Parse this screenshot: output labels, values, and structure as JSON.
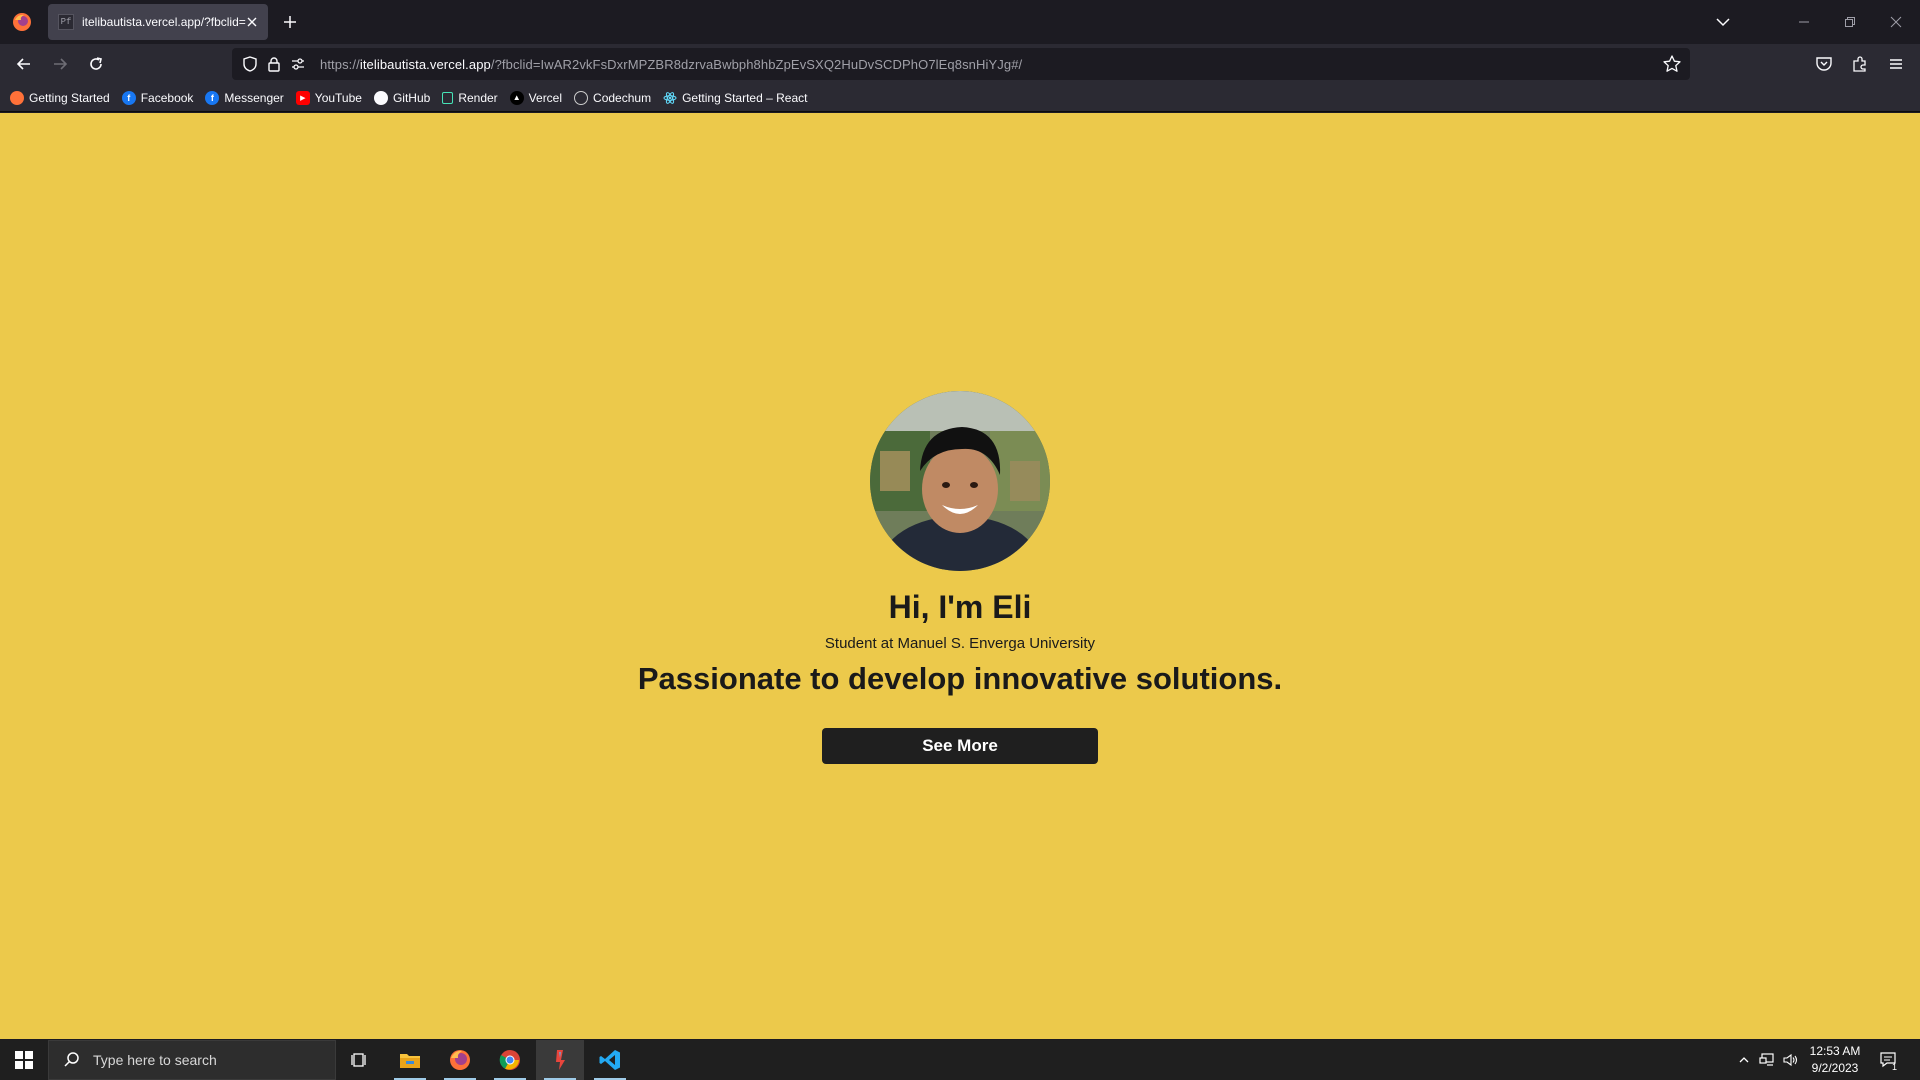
{
  "browser": {
    "tab": {
      "favicon_text": "Pf",
      "title": "itelibautista.vercel.app/?fbclid="
    },
    "url": {
      "scheme": "https://",
      "host": "itelibautista.vercel.app",
      "path": "/?fbclid=IwAR2vkFsDxrMPZBR8dzrvaBwbph8hbZpEvSXQ2HuDvSCDPhO7lEq8snHiYJg#/"
    },
    "bookmarks": [
      {
        "label": "Getting Started",
        "icon": "firefox-icon",
        "color": "#ff7139"
      },
      {
        "label": "Facebook",
        "icon": "facebook-icon",
        "color": "#1877f2"
      },
      {
        "label": "Messenger",
        "icon": "facebook-icon",
        "color": "#1877f2"
      },
      {
        "label": "YouTube",
        "icon": "youtube-icon",
        "color": "#ff0000"
      },
      {
        "label": "GitHub",
        "icon": "github-icon",
        "color": "#ffffff"
      },
      {
        "label": "Render",
        "icon": "render-icon",
        "color": "#46e3b7"
      },
      {
        "label": "Vercel",
        "icon": "vercel-icon",
        "color": "#ffffff"
      },
      {
        "label": "Codechum",
        "icon": "codechum-icon",
        "color": "#cccccc"
      },
      {
        "label": "Getting Started – React",
        "icon": "react-icon",
        "color": "#61dafb"
      }
    ]
  },
  "page": {
    "background": "#ecc94b",
    "greeting": "Hi, I'm Eli",
    "subtitle": "Student at Manuel S. Enverga University",
    "tagline": "Passionate to develop innovative solutions.",
    "cta_label": "See More"
  },
  "taskbar": {
    "search_placeholder": "Type here to search",
    "apps": [
      "task-view-icon",
      "file-explorer-icon",
      "firefox-icon",
      "chrome-icon",
      "app-icon",
      "vscode-icon"
    ],
    "time": "12:53 AM",
    "date": "9/2/2023",
    "notification_count": "1"
  }
}
